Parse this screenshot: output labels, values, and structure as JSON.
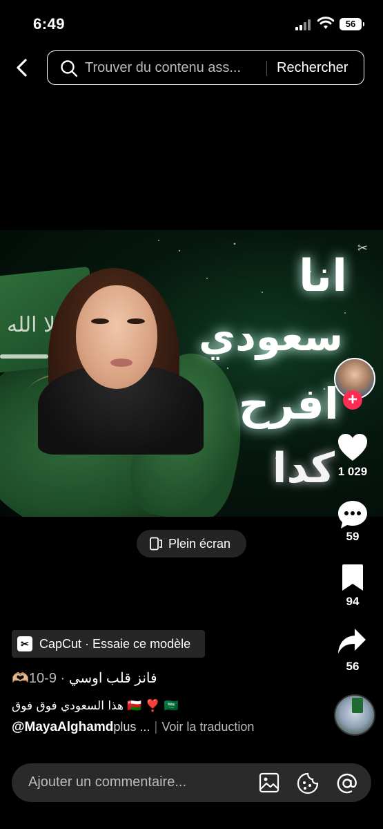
{
  "status_bar": {
    "time": "6:49",
    "battery": "56"
  },
  "search": {
    "placeholder": "Trouver du contenu ass...",
    "button_label": "Rechercher"
  },
  "video": {
    "overlay_lines": [
      "انا",
      "سعودي",
      "افرح",
      "كدا"
    ],
    "flag_text": "لا إله إلا الله",
    "fullscreen_label": "Plein écran"
  },
  "rail": {
    "likes": "1 029",
    "comments": "59",
    "saves": "94",
    "shares": "56"
  },
  "post": {
    "capcut_label": "CapCut · Essaie ce modèle",
    "date": "9-10",
    "meta_separator": " · ",
    "title": "فانز قلب اوسي",
    "title_emoji": "🫶🏼",
    "description": "هذا السعودي فوق فوق 🇴🇲 ❣️ 🇸🇦",
    "author": "@MayaAlghamd",
    "more": "plus ...",
    "translate": "Voir la traduction"
  },
  "comment_bar": {
    "placeholder": "Ajouter un commentaire..."
  },
  "colors": {
    "accent": "#fe2c55",
    "background": "#000000",
    "surface": "#262626"
  },
  "icons": [
    "back-icon",
    "search-icon",
    "fullscreen-icon",
    "heart-icon",
    "comment-icon",
    "bookmark-icon",
    "share-icon",
    "image-icon",
    "emoji-icon",
    "mention-icon",
    "capcut-icon"
  ]
}
